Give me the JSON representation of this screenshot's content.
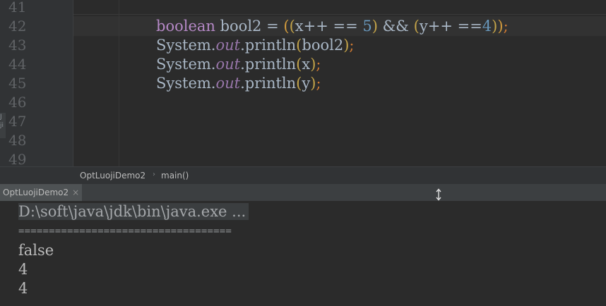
{
  "editor": {
    "line_numbers": [
      "41",
      "42",
      "43",
      "44",
      "45",
      "46",
      "47",
      "48",
      "49"
    ],
    "line42": {
      "keyword": "boolean",
      "var": " bool2 = ",
      "p_open_outer": "(",
      "p_open_inner1": "(",
      "expr1": "x++ == ",
      "num1": "5",
      "p_close_inner1": ")",
      "and_op": " && ",
      "p_open_inner2": "(",
      "expr2": "y++ ==",
      "num2": "4",
      "p_close_inner2": ")",
      "p_close_outer": ")",
      "semi": ";"
    },
    "line43": {
      "prefix": "System.",
      "field": "out",
      "method": ".println",
      "p_open": "(",
      "arg": "bool2",
      "p_close": ")",
      "semi": ";"
    },
    "line44": {
      "prefix": "System.",
      "field": "out",
      "method": ".println",
      "p_open": "(",
      "arg": "x",
      "p_close": ")",
      "semi": ";"
    },
    "line45": {
      "prefix": "System.",
      "field": "out",
      "method": ".println",
      "p_open": "(",
      "arg": "y",
      "p_close": ")",
      "semi": ";"
    },
    "side_stub": [
      "J",
      "ji"
    ]
  },
  "breadcrumb": {
    "class_name": "OptLuojiDemo2",
    "separator": "›",
    "method_name": "main()"
  },
  "run_panel": {
    "tab_label": "OptLuojiDemo2",
    "tab_close": "×"
  },
  "console": {
    "command": "D:\\soft\\java\\jdk\\bin\\java.exe ...",
    "separator": "===================================",
    "outputs": [
      "false",
      "4",
      "4"
    ]
  },
  "colors": {
    "editor_bg": "#2b2b2b",
    "gutter_bg": "#313335",
    "keyword": "#b689c7",
    "number": "#6897bb",
    "field": "#9876aa",
    "semicolon": "#cc7832",
    "text": "#a9b7c6"
  }
}
